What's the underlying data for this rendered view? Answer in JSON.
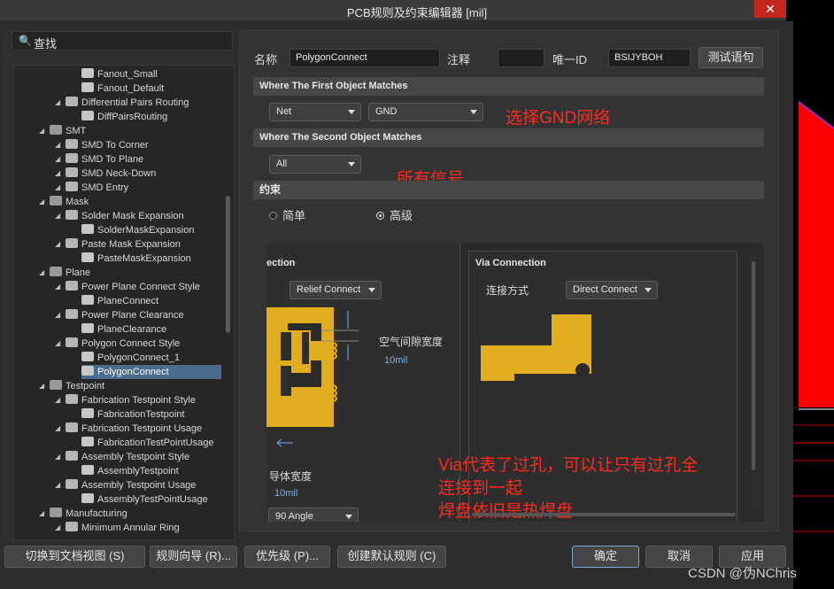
{
  "window": {
    "title": "PCB规则及约束编辑器 [mil]",
    "close_label": "✕"
  },
  "search": {
    "placeholder": "查找"
  },
  "tree": {
    "items": [
      {
        "label": "Fanout_Small",
        "level": 4
      },
      {
        "label": "Fanout_Default",
        "level": 4
      },
      {
        "label": "Differential Pairs Routing",
        "level": 3
      },
      {
        "label": "DiffPairsRouting",
        "level": 4
      },
      {
        "label": "SMT",
        "level": 2
      },
      {
        "label": "SMD To Corner",
        "level": 3
      },
      {
        "label": "SMD To Plane",
        "level": 3
      },
      {
        "label": "SMD Neck-Down",
        "level": 3
      },
      {
        "label": "SMD Entry",
        "level": 3
      },
      {
        "label": "Mask",
        "level": 2
      },
      {
        "label": "Solder Mask Expansion",
        "level": 3
      },
      {
        "label": "SolderMaskExpansion",
        "level": 4
      },
      {
        "label": "Paste Mask Expansion",
        "level": 3
      },
      {
        "label": "PasteMaskExpansion",
        "level": 4
      },
      {
        "label": "Plane",
        "level": 2
      },
      {
        "label": "Power Plane Connect Style",
        "level": 3
      },
      {
        "label": "PlaneConnect",
        "level": 4
      },
      {
        "label": "Power Plane Clearance",
        "level": 3
      },
      {
        "label": "PlaneClearance",
        "level": 4
      },
      {
        "label": "Polygon Connect Style",
        "level": 3
      },
      {
        "label": "PolygonConnect_1",
        "level": 4
      },
      {
        "label": "PolygonConnect",
        "level": 4,
        "selected": true
      },
      {
        "label": "Testpoint",
        "level": 2
      },
      {
        "label": "Fabrication Testpoint Style",
        "level": 3
      },
      {
        "label": "FabricationTestpoint",
        "level": 4
      },
      {
        "label": "Fabrication Testpoint Usage",
        "level": 3
      },
      {
        "label": "FabricationTestPointUsage",
        "level": 4
      },
      {
        "label": "Assembly Testpoint Style",
        "level": 3
      },
      {
        "label": "AssemblyTestpoint",
        "level": 4
      },
      {
        "label": "Assembly Testpoint Usage",
        "level": 3
      },
      {
        "label": "AssemblyTestPointUsage",
        "level": 4
      },
      {
        "label": "Manufacturing",
        "level": 2
      },
      {
        "label": "Minimum Annular Ring",
        "level": 3
      }
    ]
  },
  "rule": {
    "name_label": "名称",
    "name_value": "PolygonConnect",
    "comment_label": "注释",
    "comment_value": "",
    "uid_label": "唯一ID",
    "uid_value": "BSIJYBOH",
    "test_button": "测试语句"
  },
  "first_match": {
    "header": "Where The First Object Matches",
    "type": "Net",
    "value": "GND",
    "annotation": "选择GND网络"
  },
  "second_match": {
    "header": "Where The Second Object Matches",
    "type": "All",
    "annotation": "所有信号"
  },
  "constraints": {
    "header": "约束",
    "simple_label": "简单",
    "advanced_label": "高级",
    "mode": "advanced",
    "pad_title": "ection",
    "pad_connect": "Relief Connect",
    "air_gap_label": "空气间隙宽度",
    "air_gap_value": "10mil",
    "conductor_label": "导体宽度",
    "conductor_value": "10mil",
    "angle": "90 Angle",
    "via_title": "Via Connection",
    "via_connect_label": "连接方式",
    "via_connect": "Direct Connect",
    "annotation_lines": [
      "Via代表了过孔，可以让只有过孔全",
      "连接到一起",
      "焊盘依旧是热焊盘"
    ]
  },
  "footer": {
    "switch_doc": "切换到文档视图 (S)",
    "wizard": "规则向导 (R)...",
    "priority": "优先级 (P)...",
    "default_rules": "创建默认规则 (C)",
    "ok": "确定",
    "cancel": "取消",
    "apply": "应用"
  },
  "watermark": "CSDN @伪NChris",
  "colors": {
    "copper": "#e2ae1f",
    "annotation": "#ff2a1f",
    "selection": "#4a6a8e"
  }
}
